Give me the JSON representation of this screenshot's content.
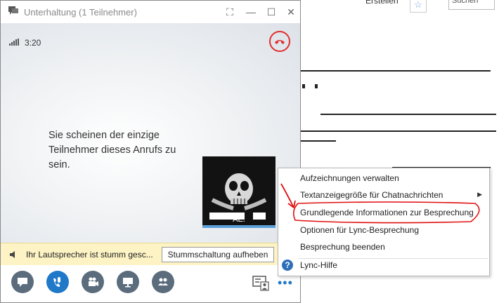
{
  "window": {
    "title": "Unterhaltung (1 Teilnehmer)"
  },
  "call": {
    "timer": "3:20",
    "solo_message": "Sie scheinen der einzige Teilnehmer dieses Anrufs zu sein.",
    "self_label": "AE."
  },
  "notice": {
    "text": "Ihr Lautsprecher ist stumm gesc...",
    "button": "Stummschaltung aufheben"
  },
  "menu": {
    "items": [
      "Aufzeichnungen verwalten",
      "Textanzeigegröße für Chatnachrichten",
      "Grundlegende Informationen zur Besprechung",
      "Optionen für Lync-Besprechung",
      "Besprechung beenden",
      "Lync-Hilfe"
    ]
  },
  "background": {
    "tab_label": "Erstellen",
    "search_placeholder": "Suchen"
  },
  "colors": {
    "accent": "#1f78c8",
    "hangup": "#e03030",
    "notice_bg": "#fdf3c4",
    "annotation": "#e01010"
  },
  "icons": {
    "title": "conversation-icon",
    "hangup": "phone-hangup-icon",
    "notice": "speaker-muted-icon",
    "controls": [
      "chat-icon",
      "phone-mic-icon",
      "video-camera-icon",
      "presentation-icon",
      "participants-icon"
    ],
    "help": "help-icon"
  }
}
